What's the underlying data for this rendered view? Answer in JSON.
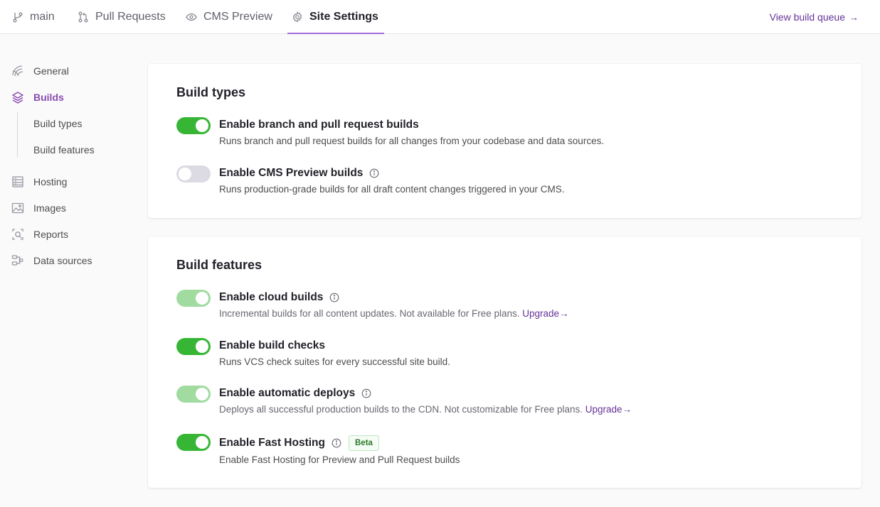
{
  "topbar": {
    "tabs": [
      {
        "label": "main",
        "icon": "branch-icon"
      },
      {
        "label": "Pull Requests",
        "icon": "pull-request-icon"
      },
      {
        "label": "CMS Preview",
        "icon": "eye-icon"
      },
      {
        "label": "Site Settings",
        "icon": "gear-icon",
        "active": true
      }
    ],
    "build_queue_label": "View build queue"
  },
  "sidebar": {
    "items": [
      {
        "label": "General",
        "icon": "general-icon"
      },
      {
        "label": "Builds",
        "icon": "layers-icon",
        "active": true
      },
      {
        "label": "Hosting",
        "icon": "server-icon"
      },
      {
        "label": "Images",
        "icon": "image-icon"
      },
      {
        "label": "Reports",
        "icon": "reports-icon"
      },
      {
        "label": "Data sources",
        "icon": "data-sources-icon"
      }
    ],
    "sub_items": [
      {
        "label": "Build types"
      },
      {
        "label": "Build features"
      }
    ]
  },
  "build_types": {
    "title": "Build types",
    "rows": [
      {
        "label": "Enable branch and pull request builds",
        "desc": "Runs branch and pull request builds for all changes from your codebase and data sources.",
        "enabled": true
      },
      {
        "label": "Enable CMS Preview builds",
        "desc": "Runs production-grade builds for all draft content changes triggered in your CMS.",
        "enabled": false
      }
    ]
  },
  "build_features": {
    "title": "Build features",
    "rows": [
      {
        "label": "Enable cloud builds",
        "desc": "Incremental builds for all content updates. Not available for Free plans.",
        "link": "Upgrade",
        "enabled": true,
        "disabled": true
      },
      {
        "label": "Enable build checks",
        "desc": "Runs VCS check suites for every successful site build.",
        "enabled": true
      },
      {
        "label": "Enable automatic deploys",
        "desc": "Deploys all successful production builds to the CDN. Not customizable for Free plans.",
        "link": "Upgrade",
        "enabled": true,
        "disabled": true
      },
      {
        "label": "Enable Fast Hosting",
        "badge": "Beta",
        "desc": "Enable Fast Hosting for Preview and Pull Request builds",
        "enabled": true
      }
    ]
  },
  "colors": {
    "accent": "#663399",
    "active_tab_underline": "#a26ed8",
    "toggle_on": "#37b635",
    "toggle_disabled": "#a1dba0",
    "toggle_off": "#dcdbe3"
  }
}
